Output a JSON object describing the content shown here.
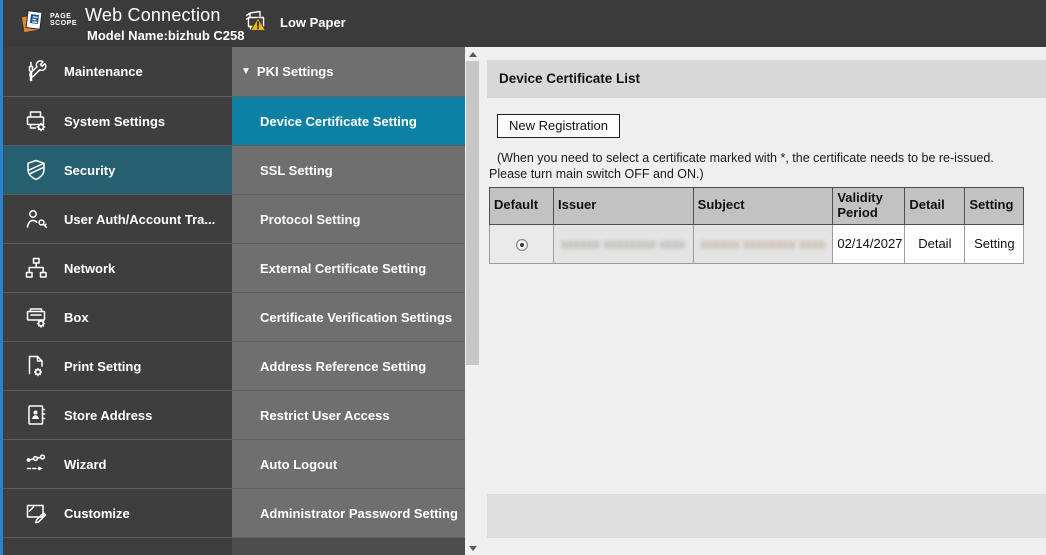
{
  "header": {
    "logo_line1": "PAGE",
    "logo_line2": "SCOPE",
    "title": "Web Connection",
    "model": "Model Name:bizhub C258",
    "status": {
      "label": "Low Paper",
      "icon": "printer-warning-icon",
      "warning_color": "#f2b705"
    }
  },
  "sidebar": {
    "items": [
      {
        "label": "Maintenance",
        "icon": "tools-icon",
        "selected": false
      },
      {
        "label": "System Settings",
        "icon": "printer-gear-icon",
        "selected": false
      },
      {
        "label": "Security",
        "icon": "shield-icon",
        "selected": true
      },
      {
        "label": "User Auth/Account Tra...",
        "icon": "user-key-icon",
        "selected": false
      },
      {
        "label": "Network",
        "icon": "network-nodes-icon",
        "selected": false
      },
      {
        "label": "Box",
        "icon": "box-gear-icon",
        "selected": false
      },
      {
        "label": "Print Setting",
        "icon": "page-gear-icon",
        "selected": false
      },
      {
        "label": "Store Address",
        "icon": "address-book-icon",
        "selected": false
      },
      {
        "label": "Wizard",
        "icon": "wizard-steps-icon",
        "selected": false
      },
      {
        "label": "Customize",
        "icon": "screen-pencil-icon",
        "selected": false
      }
    ],
    "selected_color": "#265f6f"
  },
  "submenu": {
    "section_label": "PKI Settings",
    "section_expanded": true,
    "items": [
      {
        "label": "Device Certificate Setting",
        "selected": true
      },
      {
        "label": "SSL Setting",
        "selected": false
      },
      {
        "label": "Protocol Setting",
        "selected": false
      },
      {
        "label": "External Certificate Setting",
        "selected": false
      },
      {
        "label": "Certificate Verification Settings",
        "selected": false
      },
      {
        "label": "Address Reference Setting",
        "selected": false
      },
      {
        "label": "Restrict User Access",
        "selected": false
      },
      {
        "label": "Auto Logout",
        "selected": false
      },
      {
        "label": "Administrator Password Setting",
        "selected": false
      }
    ],
    "selected_color": "#0d81a4"
  },
  "main": {
    "title": "Device Certificate List",
    "new_registration_label": "New Registration",
    "note_line1": "(When you need to select a certificate marked with *, the certificate needs to be re-issued.",
    "note_line2": "Please turn main switch OFF and ON.)",
    "table": {
      "headers": {
        "default": "Default",
        "issuer": "Issuer",
        "subject": "Subject",
        "validity": "Validity Period",
        "detail": "Detail",
        "setting": "Setting"
      },
      "rows": [
        {
          "default_selected": true,
          "issuer_masked": "xxxxxx xxxxxxxx xxxx",
          "subject_masked": "xxxxxx xxxxxxxx xxxx",
          "validity_period": "02/14/2027",
          "detail_label": "Detail",
          "setting_label": "Setting"
        }
      ]
    }
  }
}
